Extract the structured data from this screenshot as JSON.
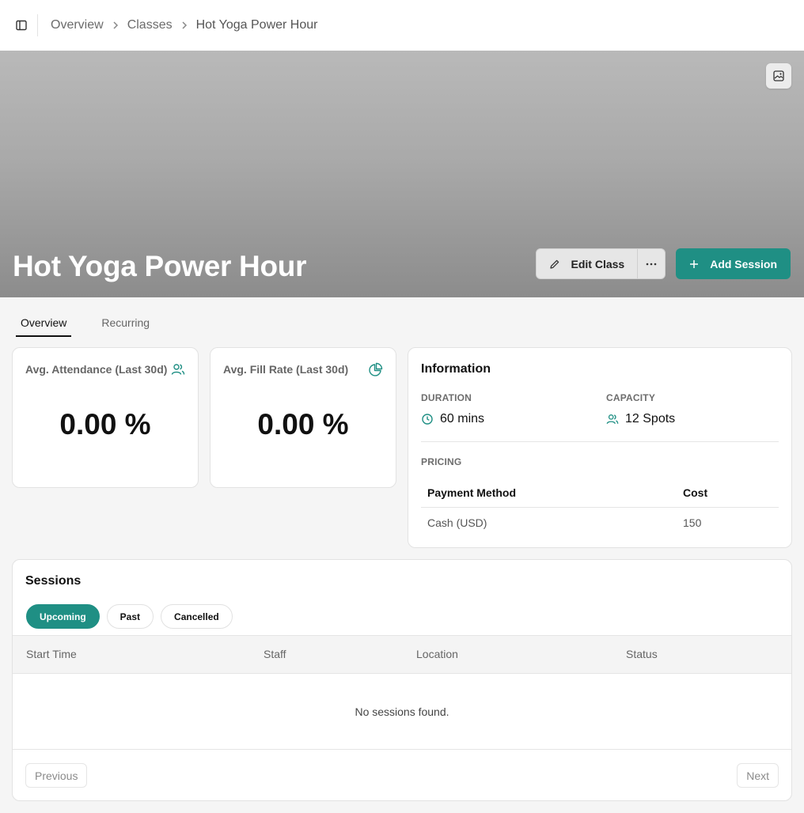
{
  "breadcrumb": {
    "items": [
      "Overview",
      "Classes",
      "Hot Yoga Power Hour"
    ]
  },
  "hero": {
    "title": "Hot Yoga Power Hour",
    "edit_label": "Edit Class",
    "add_session_label": "Add Session"
  },
  "tabs": [
    {
      "label": "Overview",
      "active": true
    },
    {
      "label": "Recurring",
      "active": false
    }
  ],
  "stats": [
    {
      "label": "Avg. Attendance (Last 30d)",
      "value": "0.00 %",
      "icon": "users-icon"
    },
    {
      "label": "Avg. Fill Rate (Last 30d)",
      "value": "0.00 %",
      "icon": "pie-chart-icon"
    }
  ],
  "information": {
    "title": "Information",
    "duration_label": "DURATION",
    "duration_value": "60 mins",
    "capacity_label": "CAPACITY",
    "capacity_value": "12 Spots",
    "pricing_label": "PRICING",
    "pricing_columns": [
      "Payment Method",
      "Cost"
    ],
    "pricing_rows": [
      {
        "method": "Cash (USD)",
        "cost": "150"
      }
    ]
  },
  "sessions": {
    "title": "Sessions",
    "filters": [
      {
        "label": "Upcoming",
        "active": true
      },
      {
        "label": "Past",
        "active": false
      },
      {
        "label": "Cancelled",
        "active": false
      }
    ],
    "columns": [
      "Start Time",
      "Staff",
      "Location",
      "Status"
    ],
    "empty_text": "No sessions found.",
    "previous_label": "Previous",
    "next_label": "Next"
  },
  "colors": {
    "accent": "#1f8f84"
  }
}
